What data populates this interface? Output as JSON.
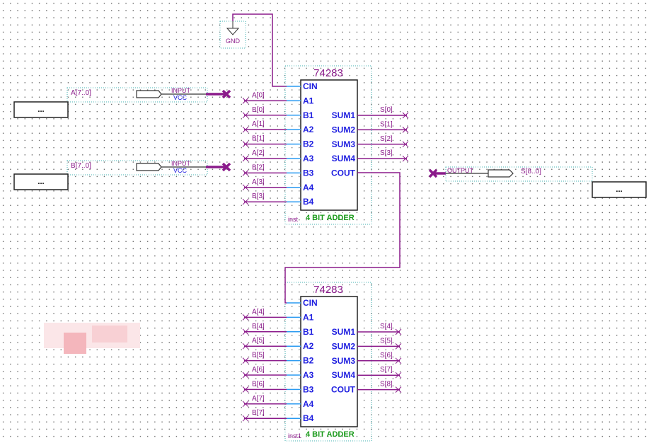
{
  "colors": {
    "wire": "#8a1a8a",
    "pin_stub": "#2a9af0",
    "pin_text": "#2020e0",
    "instance_label": "#1a9a1a",
    "outline": "#40b0b0"
  },
  "gnd": {
    "label": "GND"
  },
  "inputs": [
    {
      "name": "A[7..0]",
      "type": "INPUT",
      "default": "VCC",
      "box": "..."
    },
    {
      "name": "B[7..0]",
      "type": "INPUT",
      "default": "VCC",
      "box": "..."
    }
  ],
  "output": {
    "name": "S[8..0]",
    "type": "OUTPUT",
    "box": "..."
  },
  "blocks": [
    {
      "part": "74283",
      "description": "4 BIT ADDER",
      "instance": "inst",
      "in_pins": [
        "CIN",
        "A1",
        "B1",
        "A2",
        "B2",
        "A3",
        "B3",
        "A4",
        "B4"
      ],
      "in_nets": [
        "",
        "A[0]",
        "B[0]",
        "A[1]",
        "B[1]",
        "A[2]",
        "B[2]",
        "A[3]",
        "B[3]"
      ],
      "out_pins": [
        "SUM1",
        "SUM2",
        "SUM3",
        "SUM4",
        "COUT"
      ],
      "out_nets": [
        "S[0]",
        "S[1]",
        "S[2]",
        "S[3]",
        ""
      ]
    },
    {
      "part": "74283",
      "description": "4 BIT ADDER",
      "instance": "inst1",
      "in_pins": [
        "CIN",
        "A1",
        "B1",
        "A2",
        "B2",
        "A3",
        "B3",
        "A4",
        "B4"
      ],
      "in_nets": [
        "",
        "A[4]",
        "B[4]",
        "A[5]",
        "B[5]",
        "A[6]",
        "B[6]",
        "A[7]",
        "B[7]"
      ],
      "out_pins": [
        "SUM1",
        "SUM2",
        "SUM3",
        "SUM4",
        "COUT"
      ],
      "out_nets": [
        "S[4]",
        "S[5]",
        "S[6]",
        "S[7]",
        "S[8]"
      ]
    }
  ]
}
